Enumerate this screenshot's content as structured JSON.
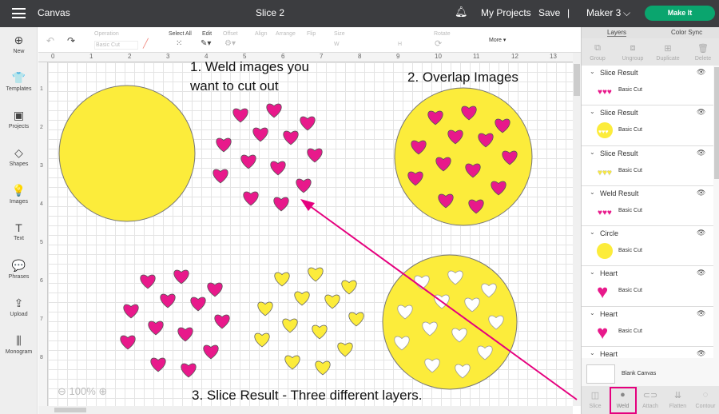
{
  "header": {
    "menu_icon": "hamburger-icon",
    "app": "Canvas",
    "title": "Slice 2",
    "bell_icon": "bell-icon",
    "my_projects": "My Projects",
    "save": "Save",
    "divider": "|",
    "machine": "Maker 3",
    "make_it": "Make It"
  },
  "sidebar": [
    {
      "icon": "⊕",
      "label": "New"
    },
    {
      "icon": "👕",
      "label": "Templates"
    },
    {
      "icon": "▣",
      "label": "Projects"
    },
    {
      "icon": "◇",
      "label": "Shapes"
    },
    {
      "icon": "💡",
      "label": "Images"
    },
    {
      "icon": "T",
      "label": "Text"
    },
    {
      "icon": "💬",
      "label": "Phrases"
    },
    {
      "icon": "⇪",
      "label": "Upload"
    },
    {
      "icon": "⫼",
      "label": "Monogram"
    }
  ],
  "toolbar": {
    "operation_label": "Operation",
    "operation_value": "Basic Cut",
    "select_all": "Select All",
    "edit": "Edit",
    "offset": "Offset",
    "align": "Align",
    "arrange": "Arrange",
    "flip": "Flip",
    "size": "Size",
    "w": "W",
    "h": "H",
    "rotate": "Rotate",
    "more": "More ▾"
  },
  "ruler_h": [
    "0",
    "1",
    "2",
    "3",
    "4",
    "5",
    "6",
    "7",
    "8",
    "9",
    "10",
    "11",
    "12",
    "13"
  ],
  "ruler_v": [
    "1",
    "2",
    "3",
    "4",
    "5",
    "6",
    "7",
    "8"
  ],
  "zoom": "100%",
  "annotations": {
    "a1_line1": "1. Weld images you",
    "a1_line2": "want to cut out",
    "a2": "2. Overlap Images",
    "a3": "3. Slice Result - Three different layers."
  },
  "colors": {
    "yellow": "#fcec3b",
    "pink": "#e8198b",
    "arrow": "#e5007e",
    "make_it": "#0aa56e"
  },
  "panel": {
    "tabs": [
      "Layers",
      "Color Sync"
    ],
    "tools": [
      "Group",
      "Ungroup",
      "Duplicate",
      "Delete"
    ],
    "layers": [
      {
        "name": "Slice Result",
        "cut": "Basic Cut",
        "thumb": "pink-hearts"
      },
      {
        "name": "Slice Result",
        "cut": "Basic Cut",
        "thumb": "yellow-circle-holes"
      },
      {
        "name": "Slice Result",
        "cut": "Basic Cut",
        "thumb": "yellow-hearts"
      },
      {
        "name": "Weld Result",
        "cut": "Basic Cut",
        "thumb": "pink-hearts"
      },
      {
        "name": "Circle",
        "cut": "Basic Cut",
        "thumb": "yellow-circle"
      },
      {
        "name": "Heart",
        "cut": "Basic Cut",
        "thumb": "pink-heart"
      },
      {
        "name": "Heart",
        "cut": "Basic Cut",
        "thumb": "pink-heart"
      },
      {
        "name": "Heart",
        "cut": "",
        "thumb": ""
      }
    ],
    "blank_canvas": "Blank Canvas",
    "bottom_tools": [
      "Slice",
      "Weld",
      "Attach",
      "Flatten",
      "Contour"
    ]
  }
}
